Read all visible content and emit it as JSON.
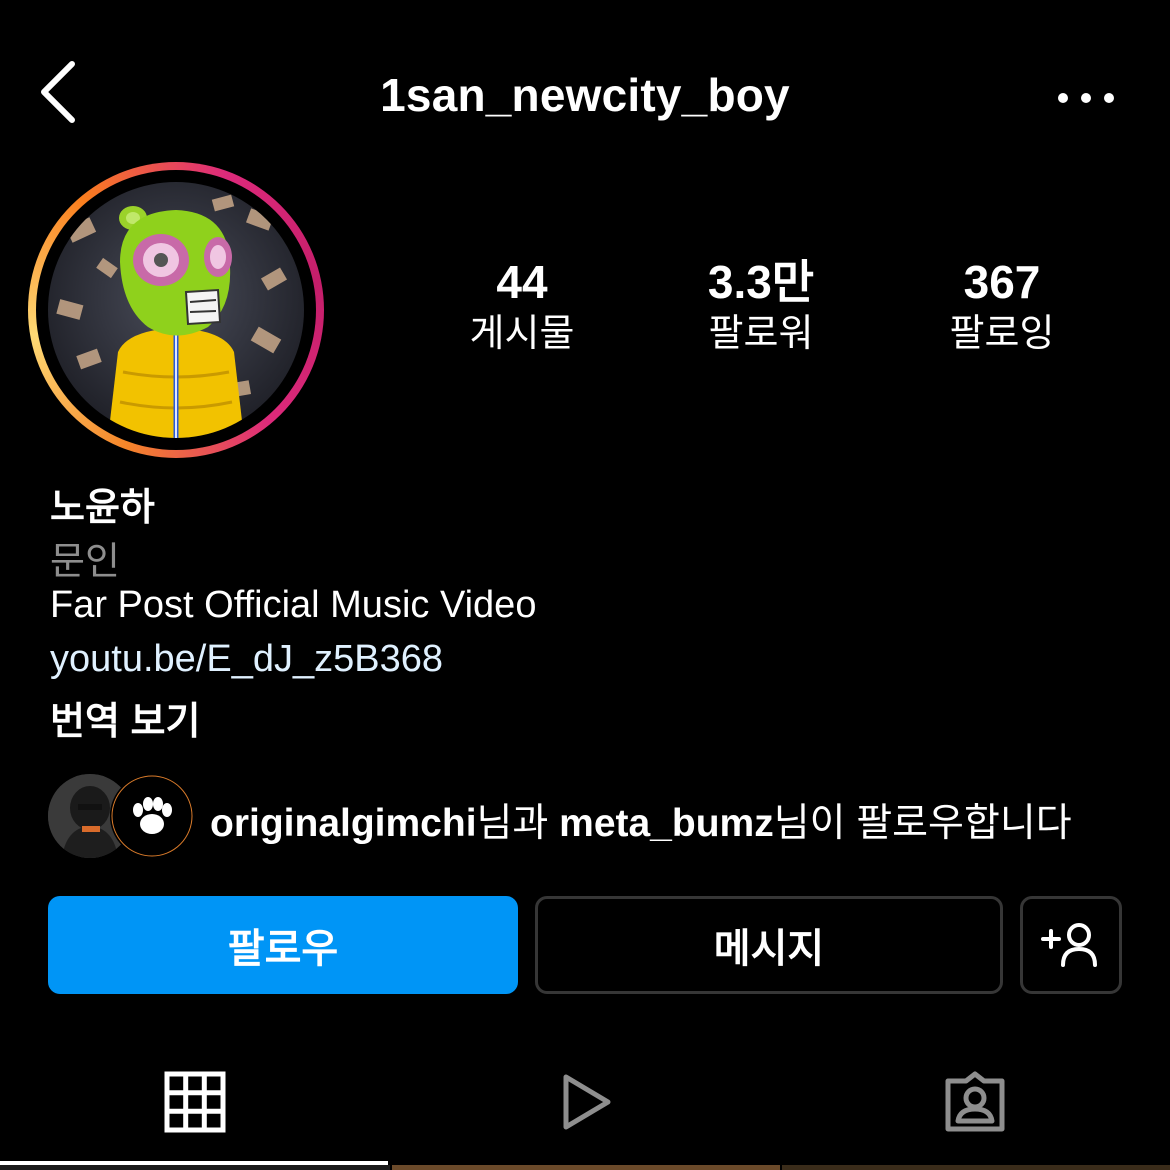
{
  "header": {
    "username": "1san_newcity_boy",
    "back_icon": "chevron-left-icon",
    "more_icon": "more-horizontal-icon"
  },
  "stats": [
    {
      "value": "44",
      "label": "게시물"
    },
    {
      "value": "3.3만",
      "label": "팔로워"
    },
    {
      "value": "367",
      "label": "팔로잉"
    }
  ],
  "profile": {
    "name": "노윤하",
    "category": "문인",
    "bio": "Far Post Official Music Video",
    "link": "youtu.be/E_dJ_z5B368",
    "translate": "번역 보기"
  },
  "followed_by": {
    "user1": "originalgimchi",
    "joiner": "님과 ",
    "user2": "meta_bumz",
    "suffix": "님이 팔로우합니다"
  },
  "buttons": {
    "follow": "팔로우",
    "message": "메시지",
    "add_user_icon": "add-user-icon"
  },
  "tabs": [
    "grid-icon",
    "reels-icon",
    "tagged-icon"
  ],
  "colors": {
    "follow_button": "#0095f6",
    "link": "#e0f1ff",
    "secondary_text": "#8e8e8e",
    "button_border": "#363636"
  }
}
